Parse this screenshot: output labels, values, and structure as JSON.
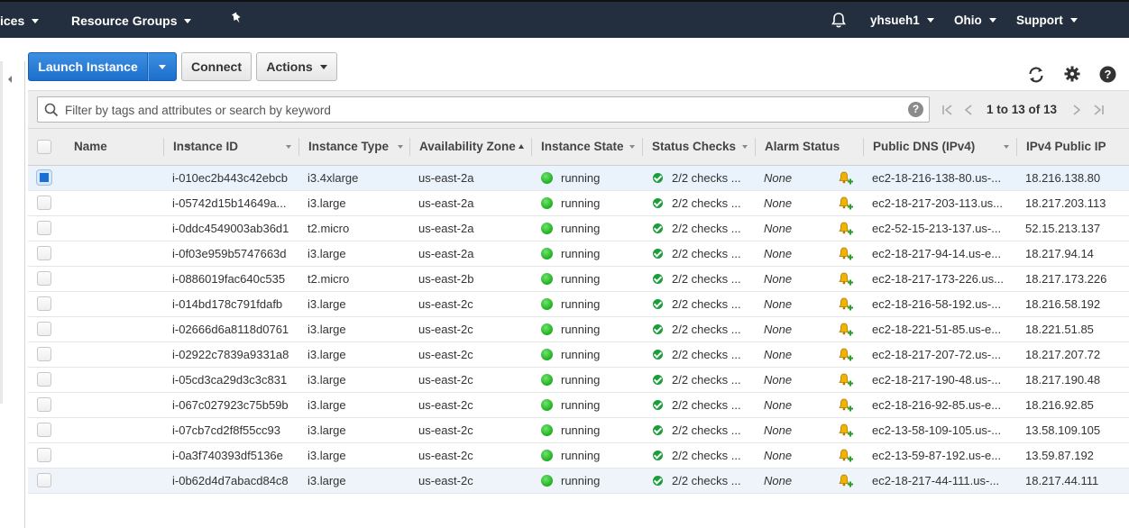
{
  "nav": {
    "services_label": "ices",
    "resource_groups_label": "Resource Groups",
    "user_label": "yhsueh1",
    "region_label": "Ohio",
    "support_label": "Support"
  },
  "toolbar": {
    "launch_label": "Launch Instance",
    "connect_label": "Connect",
    "actions_label": "Actions"
  },
  "filter": {
    "placeholder": "Filter by tags and attributes or search by keyword",
    "help": "?",
    "pagination": "1 to 13 of 13"
  },
  "columns": {
    "name": "Name",
    "instance_id": "Instance ID",
    "instance_type": "Instance Type",
    "az": "Availability Zone",
    "state": "Instance State",
    "status_checks": "Status Checks",
    "alarm_status": "Alarm Status",
    "dns": "Public DNS (IPv4)",
    "ip": "IPv4 Public IP"
  },
  "rows": [
    {
      "id": "i-010ec2b443c42ebcb",
      "type": "i3.4xlarge",
      "az": "us-east-2a",
      "state": "running",
      "checks": "2/2 checks ...",
      "alarm": "None",
      "dns": "ec2-18-216-138-80.us-...",
      "ip": "18.216.138.80",
      "selected": true
    },
    {
      "id": "i-05742d15b14649a...",
      "type": "i3.large",
      "az": "us-east-2a",
      "state": "running",
      "checks": "2/2 checks ...",
      "alarm": "None",
      "dns": "ec2-18-217-203-113.us...",
      "ip": "18.217.203.113",
      "selected": false
    },
    {
      "id": "i-0ddc4549003ab36d1",
      "type": "t2.micro",
      "az": "us-east-2a",
      "state": "running",
      "checks": "2/2 checks ...",
      "alarm": "None",
      "dns": "ec2-52-15-213-137.us-...",
      "ip": "52.15.213.137",
      "selected": false
    },
    {
      "id": "i-0f03e959b5747663d",
      "type": "i3.large",
      "az": "us-east-2a",
      "state": "running",
      "checks": "2/2 checks ...",
      "alarm": "None",
      "dns": "ec2-18-217-94-14.us-e...",
      "ip": "18.217.94.14",
      "selected": false
    },
    {
      "id": "i-0886019fac640c535",
      "type": "t2.micro",
      "az": "us-east-2b",
      "state": "running",
      "checks": "2/2 checks ...",
      "alarm": "None",
      "dns": "ec2-18-217-173-226.us...",
      "ip": "18.217.173.226",
      "selected": false
    },
    {
      "id": "i-014bd178c791fdafb",
      "type": "i3.large",
      "az": "us-east-2c",
      "state": "running",
      "checks": "2/2 checks ...",
      "alarm": "None",
      "dns": "ec2-18-216-58-192.us-...",
      "ip": "18.216.58.192",
      "selected": false
    },
    {
      "id": "i-02666d6a8118d0761",
      "type": "i3.large",
      "az": "us-east-2c",
      "state": "running",
      "checks": "2/2 checks ...",
      "alarm": "None",
      "dns": "ec2-18-221-51-85.us-e...",
      "ip": "18.221.51.85",
      "selected": false
    },
    {
      "id": "i-02922c7839a9331a8",
      "type": "i3.large",
      "az": "us-east-2c",
      "state": "running",
      "checks": "2/2 checks ...",
      "alarm": "None",
      "dns": "ec2-18-217-207-72.us-...",
      "ip": "18.217.207.72",
      "selected": false
    },
    {
      "id": "i-05cd3ca29d3c3c831",
      "type": "i3.large",
      "az": "us-east-2c",
      "state": "running",
      "checks": "2/2 checks ...",
      "alarm": "None",
      "dns": "ec2-18-217-190-48.us-...",
      "ip": "18.217.190.48",
      "selected": false
    },
    {
      "id": "i-067c027923c75b59b",
      "type": "i3.large",
      "az": "us-east-2c",
      "state": "running",
      "checks": "2/2 checks ...",
      "alarm": "None",
      "dns": "ec2-18-216-92-85.us-e...",
      "ip": "18.216.92.85",
      "selected": false
    },
    {
      "id": "i-07cb7cd2f8f55cc93",
      "type": "i3.large",
      "az": "us-east-2c",
      "state": "running",
      "checks": "2/2 checks ...",
      "alarm": "None",
      "dns": "ec2-13-58-109-105.us-...",
      "ip": "13.58.109.105",
      "selected": false
    },
    {
      "id": "i-0a3f740393df5136e",
      "type": "i3.large",
      "az": "us-east-2c",
      "state": "running",
      "checks": "2/2 checks ...",
      "alarm": "None",
      "dns": "ec2-13-59-87-192.us-e...",
      "ip": "13.59.87.192",
      "selected": false
    },
    {
      "id": "i-0b62d4d7abacd84c8",
      "type": "i3.large",
      "az": "us-east-2c",
      "state": "running",
      "checks": "2/2 checks ...",
      "alarm": "None",
      "dns": "ec2-18-217-44-111.us-...",
      "ip": "18.217.44.111",
      "selected": false,
      "hover": true
    }
  ],
  "colors": {
    "nav_bg": "#232f3e",
    "primary": "#1c6fcc",
    "running": "#1fae1f",
    "check_ok": "#1a9e3a",
    "selected_row": "#eaf2fb"
  },
  "icons": {
    "pin": "pin-icon",
    "bell": "bell-icon",
    "refresh": "refresh-icon",
    "gear": "gear-icon",
    "help": "help-icon",
    "search": "search-icon",
    "alarm_add": "bell-add-icon"
  }
}
